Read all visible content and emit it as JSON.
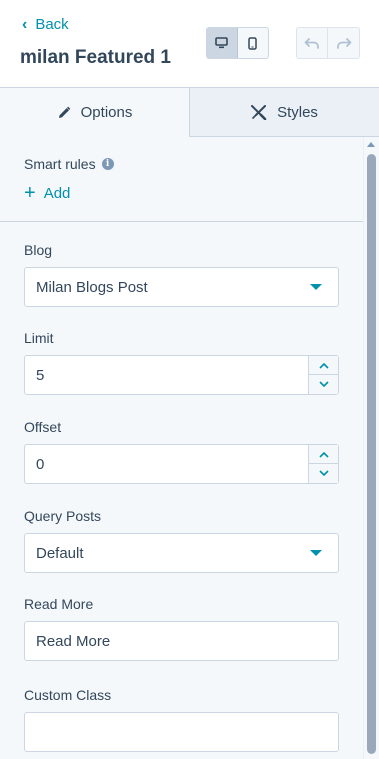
{
  "header": {
    "back_label": "Back",
    "title": "milan Featured 1",
    "devices": [
      {
        "name": "desktop",
        "icon": "desktop-icon",
        "active": true
      },
      {
        "name": "mobile",
        "icon": "mobile-icon",
        "active": false
      }
    ],
    "history": [
      {
        "name": "undo",
        "icon": "undo-icon",
        "enabled": false
      },
      {
        "name": "redo",
        "icon": "redo-icon",
        "enabled": false
      }
    ]
  },
  "tabs": [
    {
      "label": "Options",
      "icon": "pencil-icon",
      "active": true
    },
    {
      "label": "Styles",
      "icon": "brush-icon",
      "active": false
    }
  ],
  "smart_rules": {
    "label": "Smart rules",
    "add_label": "Add"
  },
  "fields": {
    "blog": {
      "label": "Blog",
      "value": "Milan Blogs Post"
    },
    "limit": {
      "label": "Limit",
      "value": "5"
    },
    "offset": {
      "label": "Offset",
      "value": "0"
    },
    "query_posts": {
      "label": "Query Posts",
      "value": "Default"
    },
    "read_more": {
      "label": "Read More",
      "value": "Read More"
    },
    "custom_class": {
      "label": "Custom Class",
      "value": ""
    }
  },
  "colors": {
    "accent": "#0091ae",
    "text": "#33475b",
    "panel": "#f5f8fa",
    "border": "#cbd6e2"
  }
}
